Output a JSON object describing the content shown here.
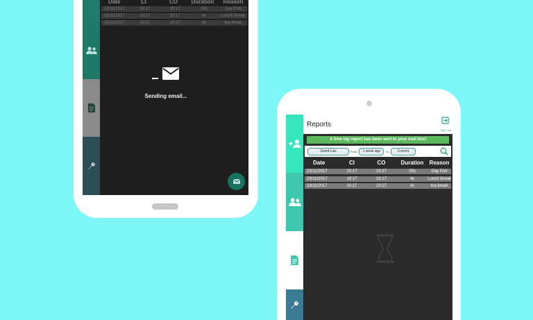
{
  "phone1": {
    "table": {
      "headers": [
        "Date",
        "CI",
        "CO",
        "Duration",
        "Reason"
      ],
      "rows": [
        [
          "23/11/2017",
          "10:17",
          "10:17",
          "29s",
          "Day End"
        ],
        [
          "23/11/2017",
          "10:17",
          "10:17",
          "4s",
          "Lunch Break"
        ],
        [
          "23/11/2017",
          "10:17",
          "10:17",
          "4s",
          "tea break"
        ]
      ]
    },
    "sending_text": "Sending email...",
    "icons": {
      "users": "users-icon",
      "document": "document-icon",
      "settings": "wrench-icon",
      "mail": "mail-icon"
    }
  },
  "phone2": {
    "title": "Reports",
    "sign_out": "Sign Out",
    "banner": "A time log report has been sent to your mail box!",
    "filter": {
      "user": "David Luis",
      "from_label": "From:",
      "from_value": "1 week ago",
      "to_label": "To:",
      "to_value": "Current"
    },
    "table": {
      "headers": [
        "Date",
        "CI",
        "CO",
        "Duration",
        "Reason"
      ],
      "rows": [
        [
          "23/11/2017",
          "10:17",
          "10:17",
          "29s",
          "Day End"
        ],
        [
          "23/11/2017",
          "10:17",
          "10:17",
          "4s",
          "Lunch Break"
        ],
        [
          "23/11/2017",
          "10:17",
          "10:17",
          "4s",
          "tea break"
        ]
      ]
    },
    "colors": {
      "accent": "#35e6bd",
      "banner": "#5cb85c",
      "background": "#7df6f8"
    }
  }
}
